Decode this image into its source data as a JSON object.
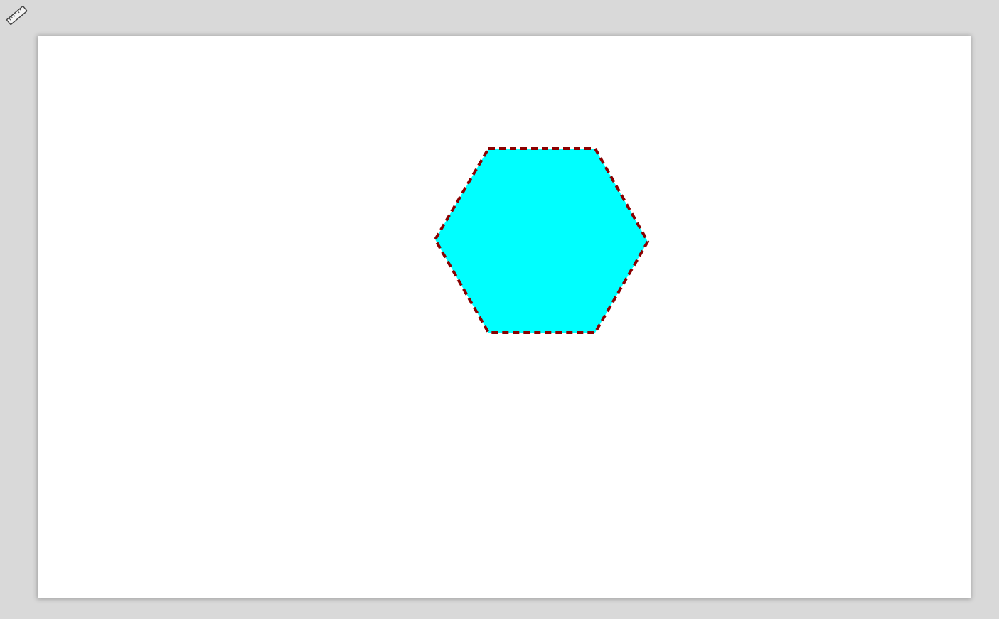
{
  "toolbar": {
    "ruler_tool": {
      "icon": "ruler-icon"
    }
  },
  "canvas": {
    "background": "#ffffff",
    "shapes": [
      {
        "kind": "hexagon",
        "fill": "#00ffff",
        "stroke": "#8b0000",
        "stroke_style": "dashed"
      }
    ]
  }
}
